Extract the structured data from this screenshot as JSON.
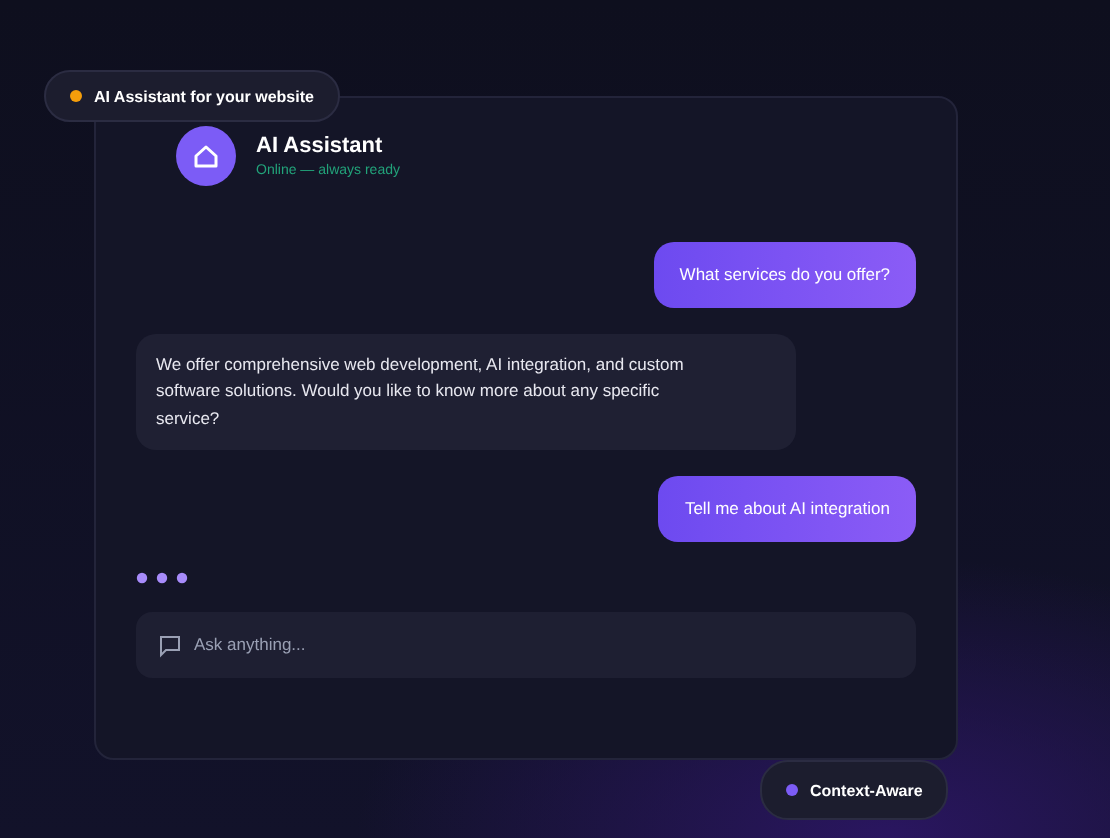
{
  "top_badge": {
    "label": "AI Assistant for your website"
  },
  "assistant": {
    "name": "AI Assistant",
    "status": "Online — always ready"
  },
  "messages": [
    {
      "kind": "user",
      "text": "What services do you offer?"
    },
    {
      "kind": "bot",
      "text": "We offer comprehensive web development, AI integration, and custom software solutions. Would you like to know more about any specific service?"
    },
    {
      "kind": "user",
      "text": "Tell me about AI integration"
    }
  ],
  "input": {
    "placeholder": "Ask anything..."
  },
  "bottom_badge": {
    "label": "Context-Aware"
  }
}
